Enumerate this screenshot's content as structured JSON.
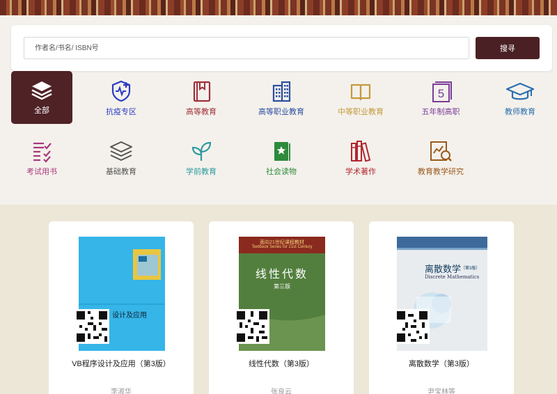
{
  "search": {
    "placeholder": "作者名/书名/ ISBN号",
    "button_label": "搜寻"
  },
  "categories": [
    {
      "label": "全部",
      "icon": "stack-layers-icon",
      "color": "#ffffff",
      "active": true
    },
    {
      "label": "抗疫专区",
      "icon": "shield-medical-icon",
      "color": "#2b3cc4"
    },
    {
      "label": "高等教育",
      "icon": "notebook-icon",
      "color": "#a0303b"
    },
    {
      "label": "高等职业教育",
      "icon": "office-building-icon",
      "color": "#2d4fa0"
    },
    {
      "label": "中等职业教育",
      "icon": "open-book-icon",
      "color": "#c49a3e"
    },
    {
      "label": "五年制高职",
      "icon": "number-five-icon",
      "color": "#7a3c99"
    },
    {
      "label": "教师教育",
      "icon": "graduation-cap-icon",
      "color": "#2b6fb0"
    },
    {
      "label": "考试用书",
      "icon": "checklist-icon",
      "color": "#a8377a"
    },
    {
      "label": "基础教育",
      "icon": "layers-outline-icon",
      "color": "#555555"
    },
    {
      "label": "学前教育",
      "icon": "sprout-icon",
      "color": "#2f9aa0"
    },
    {
      "label": "社会读物",
      "icon": "star-book-icon",
      "color": "#2e8a3c"
    },
    {
      "label": "学术著作",
      "icon": "bookshelf-icon",
      "color": "#b2272f"
    },
    {
      "label": "教育教学研究",
      "icon": "chart-magnifier-icon",
      "color": "#9a5a1e"
    }
  ],
  "books": [
    {
      "title": "VB程序设计及应用（第3版）",
      "author": "李淑华",
      "cover_text": "设计及应用"
    },
    {
      "title": "线性代数（第3版）",
      "author": "张良云",
      "cover_title": "线性代数",
      "cover_edition": "第三版",
      "cover_series": "面向21世纪课程教材",
      "cover_series_en": "Textbook Series for 21st Century"
    },
    {
      "title": "离散数学（第3版）",
      "author": "尹宝林等",
      "cover_title": "离散数学",
      "cover_edition": "（第3版）",
      "cover_title_en": "Discrete Mathematics"
    }
  ]
}
